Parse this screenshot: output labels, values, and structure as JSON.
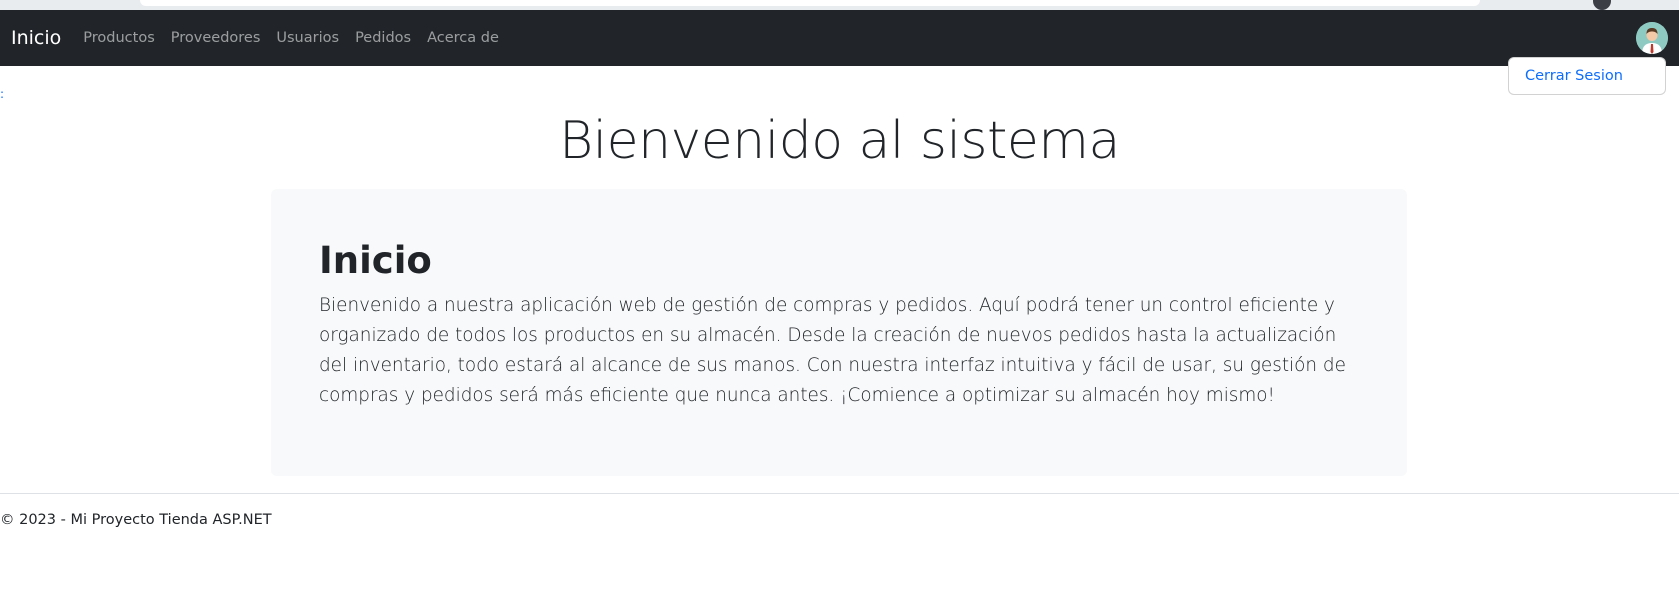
{
  "navbar": {
    "brand": "Inicio",
    "links": [
      "Productos",
      "Proveedores",
      "Usuarios",
      "Pedidos",
      "Acerca de"
    ]
  },
  "user_menu": {
    "avatar_icon": "user-avatar-icon",
    "items": [
      "Cerrar Sesion"
    ]
  },
  "main": {
    "title": "Bienvenido al sistema",
    "card": {
      "heading": "Inicio",
      "text": "Bienvenido a nuestra aplicación web de gestión de compras y pedidos. Aquí podrá tener un control eficiente y organizado de todos los productos en su almacén. Desde la creación de nuevos pedidos hasta la actualización del inventario, todo estará al alcance de sus manos. Con nuestra interfaz intuitiva y fácil de usar, su gestión de compras y pedidos será más eficiente que nunca antes. ¡Comience a optimizar su almacén hoy mismo!"
    }
  },
  "footer": {
    "text": "© 2023 - Mi Proyecto Tienda ASP.NET"
  },
  "colors": {
    "navbar_bg": "#212529",
    "link_blue": "#0d6efd",
    "card_bg": "#f8f9fa"
  }
}
